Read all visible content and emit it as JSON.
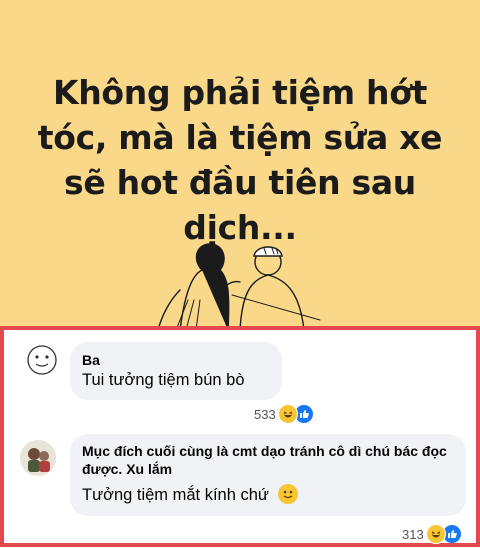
{
  "post": {
    "headline_lines": [
      "Không phải tiệm hớt",
      "tóc, mà là tiệm sửa xe",
      "sẽ hot đầu tiên sau",
      "dịch..."
    ]
  },
  "comments": [
    {
      "author": "Ba",
      "text": "Tui tưởng tiệm bún bò",
      "reaction_count": "533",
      "reaction_icons": [
        "haha-icon",
        "like-icon"
      ]
    },
    {
      "author": "Mục đích cuối cùng là cmt dạo tránh cô dì chú bác đọc được. Xu lắm",
      "text": "Tưởng tiệm mắt kính chứ",
      "trailing_emoji": "slightly-smiling-face-icon",
      "reaction_count": "313",
      "reaction_icons": [
        "haha-icon",
        "like-icon"
      ]
    }
  ],
  "colors": {
    "banner_bg": "#f9d889",
    "highlight_border": "#e5484d",
    "bubble_bg": "#f0f2f5",
    "like_blue": "#1877f2"
  }
}
